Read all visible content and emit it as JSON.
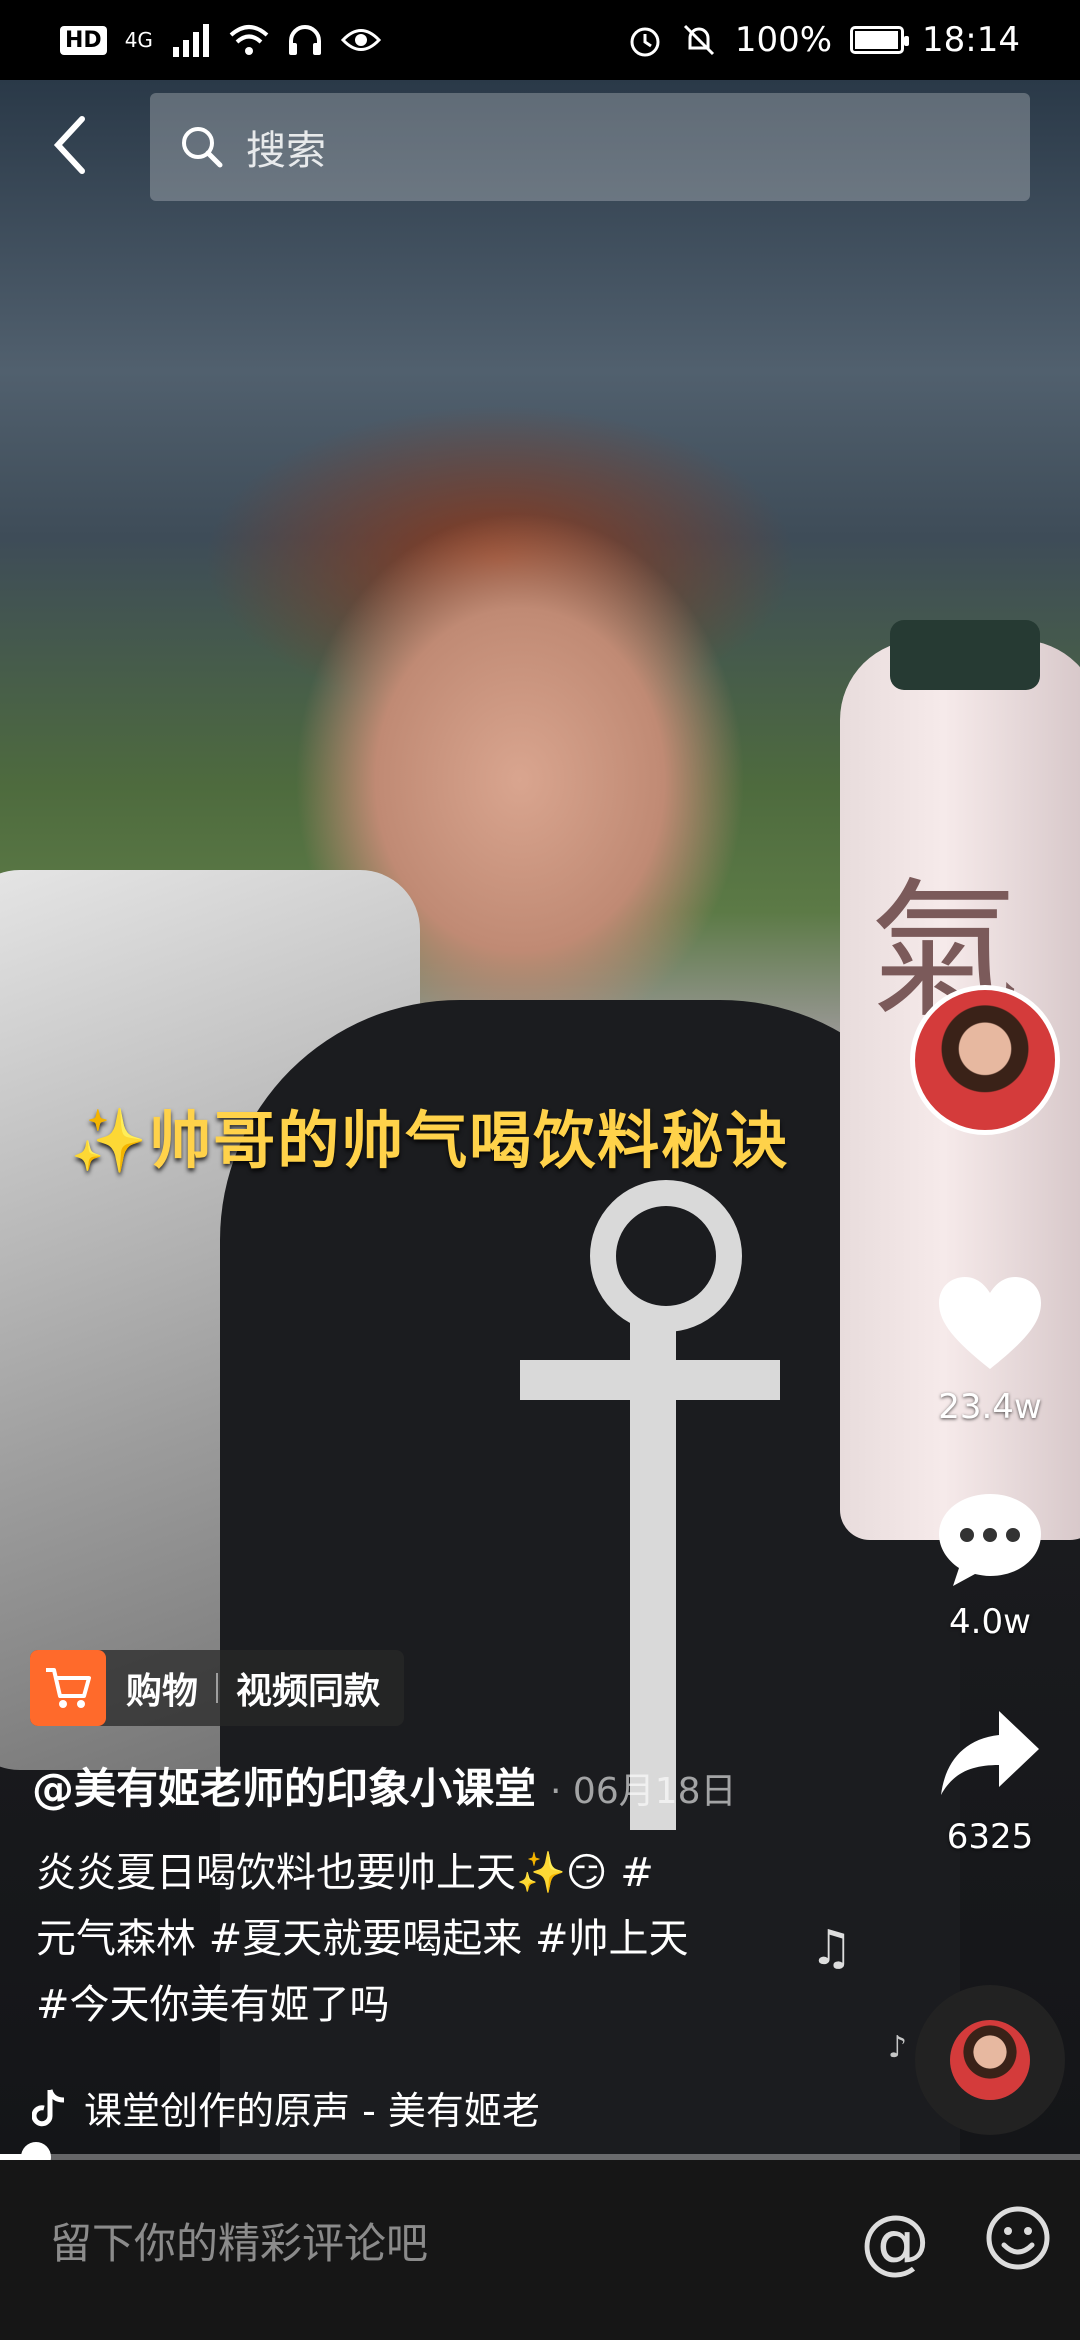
{
  "status_bar": {
    "left_badges": [
      "HD",
      "4G"
    ],
    "battery": "100%",
    "time": "18:14"
  },
  "search": {
    "placeholder": "搜索"
  },
  "overlay_caption": {
    "sparkle": "✨",
    "text": "帅哥的帅气喝饮料秘诀"
  },
  "bottle_text": "氣",
  "actions": {
    "like_count": "23.4w",
    "comment_count": "4.0w",
    "share_count": "6325"
  },
  "shopping_tag": {
    "label": "购物",
    "item": "视频同款"
  },
  "post": {
    "author": "@美有姬老师的印象小课堂",
    "date_sep": "·",
    "date": "06月18日",
    "desc_line1": "炎炎夏日喝饮料也要帅上天✨😏 #",
    "desc_line2": "元气森林 #夏天就要喝起来 #帅上天",
    "desc_line3": "#今天你美有姬了吗"
  },
  "music": {
    "title": "课堂创作的原声 - 美有姬老"
  },
  "playback": {
    "progress": 0.033
  },
  "comment_bar": {
    "placeholder": "留下你的精彩评论吧",
    "at_symbol": "@"
  },
  "colors": {
    "caption": "#ffd24a",
    "shop_orange": "#ff6a2b"
  }
}
